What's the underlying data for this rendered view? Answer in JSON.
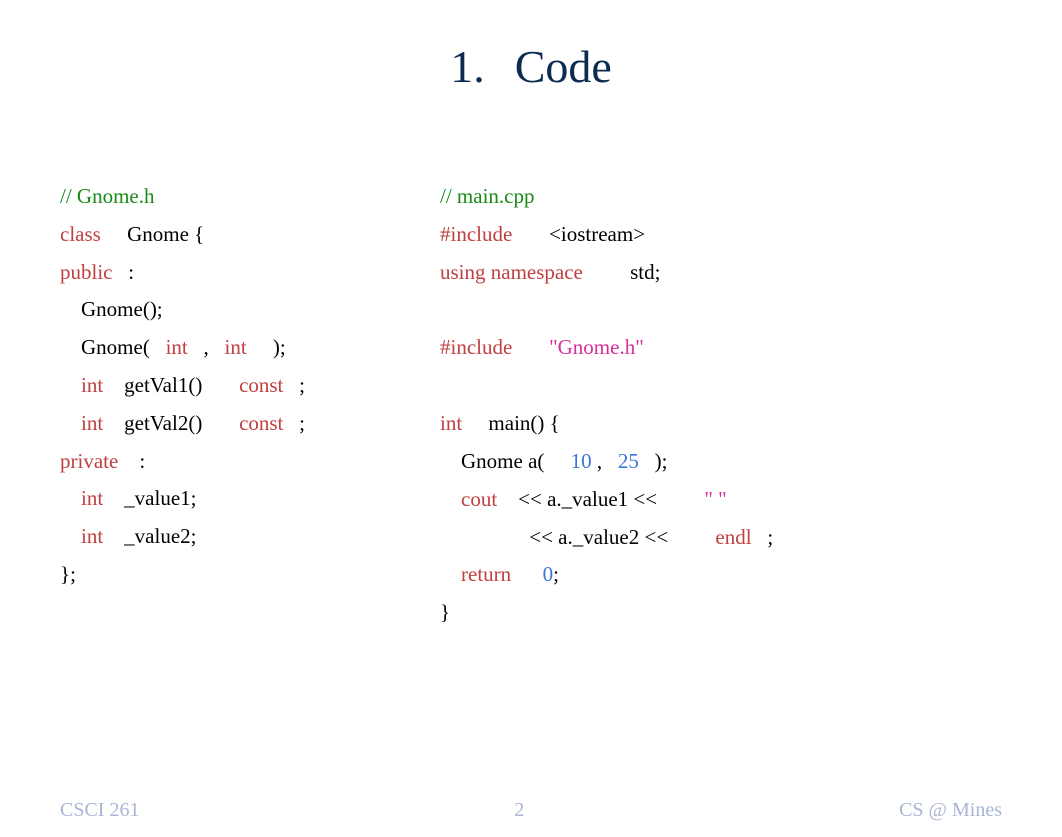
{
  "title": {
    "number": "1.",
    "text": "Code"
  },
  "left": {
    "l1_comment": "// Gnome.h",
    "l2_kw": "class",
    "l2_rest": "Gnome {",
    "l3_kw": "public",
    "l3_rest": ":",
    "l4": "    Gnome();",
    "l5_a": "    Gnome(",
    "l5_kw1": "int",
    "l5_mid": ",",
    "l5_kw2": "int",
    "l5_end": ");",
    "l6_kw": "int",
    "l6_mid": "getVal1()",
    "l6_kw2": "const",
    "l6_end": ";",
    "l7_kw": "int",
    "l7_mid": "getVal2()",
    "l7_kw2": "const",
    "l7_end": ";",
    "l8_kw": "private",
    "l8_rest": ":",
    "l9_kw": "int",
    "l9_rest": "_value1;",
    "l10_kw": "int",
    "l10_rest": "_value2;",
    "l11": "};"
  },
  "right": {
    "l1_comment": "// main.cpp",
    "l2_kw": "#include",
    "l2_rest": "<iostream>",
    "l3_kw": "using namespace",
    "l3_rest": "std;",
    "l4_kw": "#include",
    "l4_str": "\"Gnome.h\"",
    "l5_kw": "int",
    "l5_rest": "main() {",
    "l6_a": "    Gnome a(",
    "l6_n1": "10",
    "l6_mid": ",",
    "l6_n2": "25",
    "l6_end": ");",
    "l7_kw": "cout",
    "l7_a": "<< a._value1 <<",
    "l7_str": "\" \"",
    "l8_a": "<< a._value2 <<",
    "l8_kw": "endl",
    "l8_end": ";",
    "l9_kw": "return",
    "l9_n": "0",
    "l9_end": ";",
    "l10": "}"
  },
  "footer": {
    "left": "CSCI 261",
    "center": "2",
    "right": "CS @ Mines"
  }
}
